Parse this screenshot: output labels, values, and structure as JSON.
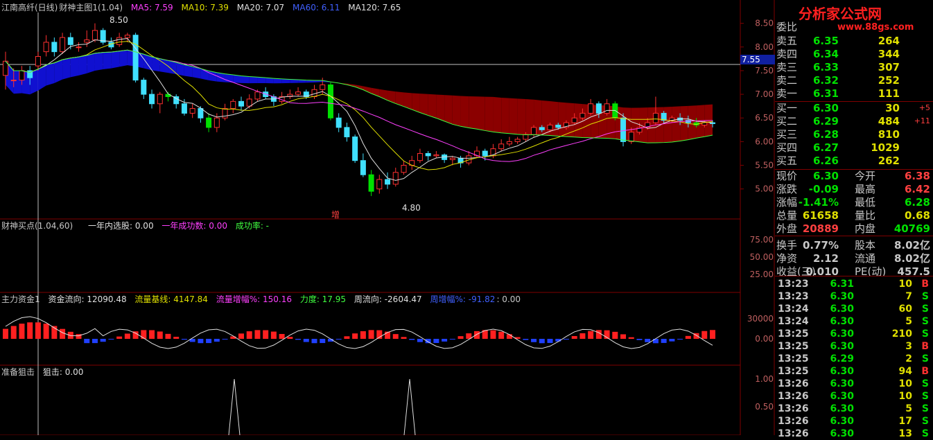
{
  "main_header": {
    "stock": "江南高纤(日线)",
    "indicator": "财神主图1(1.04)",
    "ma5": "MA5: 7.59",
    "ma10": "MA10: 7.39",
    "ma20": "MA20: 7.07",
    "ma60": "MA60: 6.11",
    "ma120": "MA120: 7.65",
    "marker_high": "8.50",
    "marker_low": "4.80",
    "marker_zeng": "增",
    "price_tag": "7.55"
  },
  "panel2_header": {
    "name": "财神买点(1.04,60)",
    "a": "一年内选股: 0.00",
    "b": "一年成功数: 0.00",
    "c": "成功率: -"
  },
  "panel3_header": {
    "name": "主力资金1",
    "a": "资金流向: 12090.48",
    "b": "流量基线: 4147.84",
    "c": "流量增幅%: 150.16",
    "d": "力度: 17.95",
    "e": "周流向: -2604.47",
    "f": "周增幅%: -91.82",
    "g": ": 0.00"
  },
  "panel4_header": {
    "name": "准备狙击",
    "a": "狙击: 0.00"
  },
  "axis": {
    "main_ticks": [
      "8.50",
      "8.00",
      "7.50",
      "7.00",
      "6.50",
      "6.00",
      "5.50",
      "5.00"
    ],
    "p2_ticks": [
      "75.00",
      "50.00",
      "25.00"
    ],
    "p3_ticks": [
      "30000",
      "0.00"
    ],
    "p4_ticks": [
      "1.00",
      "0.50"
    ]
  },
  "quote": {
    "logo": "分析家公式网",
    "logo_url": "www.88gs.com",
    "weibi": "委比",
    "sells": [
      {
        "label": "卖五",
        "price": "6.35",
        "vol": "264"
      },
      {
        "label": "卖四",
        "price": "6.34",
        "vol": "344"
      },
      {
        "label": "卖三",
        "price": "6.33",
        "vol": "307"
      },
      {
        "label": "卖二",
        "price": "6.32",
        "vol": "252"
      },
      {
        "label": "卖一",
        "price": "6.31",
        "vol": "111"
      }
    ],
    "buys": [
      {
        "label": "买一",
        "price": "6.30",
        "vol": "30",
        "chg": "+5"
      },
      {
        "label": "买二",
        "price": "6.29",
        "vol": "484",
        "chg": "+11"
      },
      {
        "label": "买三",
        "price": "6.28",
        "vol": "810",
        "chg": ""
      },
      {
        "label": "买四",
        "price": "6.27",
        "vol": "1029",
        "chg": ""
      },
      {
        "label": "买五",
        "price": "6.26",
        "vol": "262",
        "chg": ""
      }
    ],
    "stats": [
      {
        "l1": "现价",
        "v1": "6.30",
        "l2": "今开",
        "v2": "6.38",
        "c1": "#00e000",
        "c2": "#ff4040"
      },
      {
        "l1": "涨跌",
        "v1": "-0.09",
        "l2": "最高",
        "v2": "6.42",
        "c1": "#00e000",
        "c2": "#ff4040"
      },
      {
        "l1": "涨幅",
        "v1": "-1.41%",
        "l2": "最低",
        "v2": "6.28",
        "c1": "#00e000",
        "c2": "#00e000"
      },
      {
        "l1": "总量",
        "v1": "61658",
        "l2": "量比",
        "v2": "0.68",
        "c1": "#e0e000",
        "c2": "#e0e000"
      },
      {
        "l1": "外盘",
        "v1": "20889",
        "l2": "内盘",
        "v2": "40769",
        "c1": "#ff4040",
        "c2": "#00e000"
      },
      {
        "l1": "换手",
        "v1": "0.77%",
        "l2": "股本",
        "v2": "8.02亿",
        "c1": "#c8c8c8",
        "c2": "#c8c8c8"
      },
      {
        "l1": "净资",
        "v1": "2.12",
        "l2": "流通",
        "v2": "8.02亿",
        "c1": "#c8c8c8",
        "c2": "#c8c8c8"
      },
      {
        "l1": "收益(三)",
        "v1": "0.010",
        "l2": "PE(动)",
        "v2": "457.5",
        "c1": "#c8c8c8",
        "c2": "#c8c8c8"
      }
    ],
    "ticks": [
      {
        "t": "13:23",
        "p": "6.31",
        "q": "10",
        "s": "B"
      },
      {
        "t": "13:23",
        "p": "6.30",
        "q": "7",
        "s": "S"
      },
      {
        "t": "13:24",
        "p": "6.30",
        "q": "60",
        "s": "S"
      },
      {
        "t": "13:24",
        "p": "6.30",
        "q": "5",
        "s": "S"
      },
      {
        "t": "13:25",
        "p": "6.30",
        "q": "210",
        "s": "S"
      },
      {
        "t": "13:25",
        "p": "6.30",
        "q": "3",
        "s": "B"
      },
      {
        "t": "13:25",
        "p": "6.29",
        "q": "2",
        "s": "S"
      },
      {
        "t": "13:25",
        "p": "6.30",
        "q": "94",
        "s": "B"
      },
      {
        "t": "13:26",
        "p": "6.30",
        "q": "10",
        "s": "S"
      },
      {
        "t": "13:26",
        "p": "6.30",
        "q": "10",
        "s": "S"
      },
      {
        "t": "13:26",
        "p": "6.30",
        "q": "5",
        "s": "S"
      },
      {
        "t": "13:26",
        "p": "6.30",
        "q": "17",
        "s": "S"
      },
      {
        "t": "13:26",
        "p": "6.30",
        "q": "13",
        "s": "S"
      }
    ]
  },
  "chart_data": {
    "type": "candlestick",
    "ylim": [
      4.6,
      8.7
    ],
    "candles": [
      [
        7.4,
        7.7,
        7.9,
        7.1
      ],
      [
        7.3,
        7.3,
        7.55,
        7.15
      ],
      [
        7.3,
        7.5,
        7.6,
        7.2
      ],
      [
        7.5,
        7.35,
        7.6,
        7.2
      ],
      [
        7.6,
        7.8,
        7.9,
        7.5
      ],
      [
        7.9,
        8.1,
        8.25,
        7.8
      ],
      [
        8.1,
        7.9,
        8.2,
        7.8
      ],
      [
        7.9,
        8.2,
        8.3,
        7.85
      ],
      [
        8.2,
        8.05,
        8.3,
        7.95
      ],
      [
        8.0,
        8.0,
        8.1,
        7.9
      ],
      [
        8.1,
        8.15,
        8.35,
        8.0
      ],
      [
        8.15,
        8.35,
        8.5,
        8.1
      ],
      [
        8.35,
        8.1,
        8.4,
        8.05
      ],
      [
        8.1,
        8.0,
        8.2,
        7.95
      ],
      [
        8.05,
        8.2,
        8.3,
        8.0
      ],
      [
        8.2,
        8.25,
        8.3,
        8.1
      ],
      [
        8.25,
        7.3,
        8.3,
        7.25
      ],
      [
        7.3,
        7.0,
        7.35,
        6.9
      ],
      [
        7.0,
        6.8,
        7.1,
        6.7
      ],
      [
        6.8,
        7.0,
        7.05,
        6.6
      ],
      [
        7.0,
        6.95,
        7.05,
        6.85
      ],
      [
        6.95,
        6.8,
        7.0,
        6.7
      ],
      [
        6.8,
        6.6,
        6.9,
        6.55
      ],
      [
        6.6,
        6.7,
        6.8,
        6.5
      ],
      [
        6.7,
        6.5,
        6.75,
        6.4
      ],
      [
        6.5,
        6.3,
        6.6,
        6.2
      ],
      [
        6.3,
        6.5,
        6.6,
        6.2
      ],
      [
        6.5,
        6.7,
        6.8,
        6.45
      ],
      [
        6.7,
        6.85,
        6.9,
        6.6
      ],
      [
        6.85,
        6.75,
        6.95,
        6.65
      ],
      [
        6.75,
        6.9,
        7.0,
        6.7
      ],
      [
        6.9,
        7.05,
        7.1,
        6.85
      ],
      [
        7.05,
        6.95,
        7.15,
        6.9
      ],
      [
        6.95,
        6.85,
        7.0,
        6.75
      ],
      [
        6.85,
        6.95,
        7.05,
        6.8
      ],
      [
        6.95,
        7.0,
        7.1,
        6.9
      ],
      [
        7.0,
        7.05,
        7.15,
        6.95
      ],
      [
        7.05,
        6.95,
        7.1,
        6.9
      ],
      [
        6.95,
        7.1,
        7.2,
        6.9
      ],
      [
        7.1,
        7.2,
        7.35,
        7.0
      ],
      [
        7.2,
        6.5,
        7.25,
        6.45
      ],
      [
        6.5,
        6.3,
        6.6,
        6.2
      ],
      [
        6.3,
        6.1,
        6.4,
        6.0
      ],
      [
        6.1,
        5.6,
        6.15,
        5.55
      ],
      [
        5.6,
        5.3,
        5.75,
        5.25
      ],
      [
        5.3,
        4.95,
        5.4,
        4.85
      ],
      [
        5.0,
        5.2,
        5.3,
        4.9
      ],
      [
        5.2,
        5.1,
        5.35,
        5.0
      ],
      [
        5.1,
        5.35,
        5.45,
        5.05
      ],
      [
        5.35,
        5.5,
        5.6,
        5.3
      ],
      [
        5.5,
        5.6,
        5.7,
        5.4
      ],
      [
        5.6,
        5.75,
        5.85,
        5.55
      ],
      [
        5.75,
        5.7,
        5.8,
        5.6
      ],
      [
        5.7,
        5.72,
        5.8,
        5.65
      ],
      [
        5.72,
        5.62,
        5.75,
        5.55
      ],
      [
        5.62,
        5.65,
        5.7,
        5.5
      ],
      [
        5.65,
        5.55,
        5.7,
        5.45
      ],
      [
        5.55,
        5.7,
        5.8,
        5.5
      ],
      [
        5.7,
        5.8,
        5.9,
        5.65
      ],
      [
        5.8,
        5.7,
        5.85,
        5.6
      ],
      [
        5.7,
        5.85,
        5.95,
        5.65
      ],
      [
        5.85,
        5.95,
        6.05,
        5.8
      ],
      [
        5.95,
        6.0,
        6.1,
        5.9
      ],
      [
        6.0,
        6.05,
        6.1,
        5.95
      ],
      [
        6.05,
        6.15,
        6.2,
        6.0
      ],
      [
        6.15,
        6.3,
        6.35,
        6.1
      ],
      [
        6.3,
        6.25,
        6.35,
        6.2
      ],
      [
        6.25,
        6.35,
        6.4,
        6.2
      ],
      [
        6.35,
        6.3,
        6.4,
        6.25
      ],
      [
        6.3,
        6.4,
        6.45,
        6.25
      ],
      [
        6.4,
        6.5,
        6.6,
        6.35
      ],
      [
        6.5,
        6.6,
        6.7,
        6.45
      ],
      [
        6.6,
        6.8,
        6.9,
        6.55
      ],
      [
        6.8,
        6.6,
        6.85,
        6.5
      ],
      [
        6.6,
        6.8,
        6.9,
        6.55
      ],
      [
        6.8,
        6.5,
        6.85,
        6.45
      ],
      [
        6.5,
        6.0,
        6.6,
        5.9
      ],
      [
        6.0,
        6.2,
        6.3,
        5.95
      ],
      [
        6.2,
        6.3,
        6.4,
        6.15
      ],
      [
        6.3,
        6.4,
        6.5,
        6.25
      ],
      [
        6.4,
        6.6,
        6.95,
        6.35
      ],
      [
        6.6,
        6.45,
        6.65,
        6.4
      ],
      [
        6.45,
        6.5,
        6.55,
        6.4
      ],
      [
        6.5,
        6.45,
        6.6,
        6.35
      ],
      [
        6.45,
        6.4,
        6.55,
        6.3
      ],
      [
        6.4,
        6.35,
        6.5,
        6.3
      ],
      [
        6.35,
        6.4,
        6.45,
        6.3
      ],
      [
        6.4,
        6.38,
        6.45,
        6.3
      ]
    ]
  }
}
